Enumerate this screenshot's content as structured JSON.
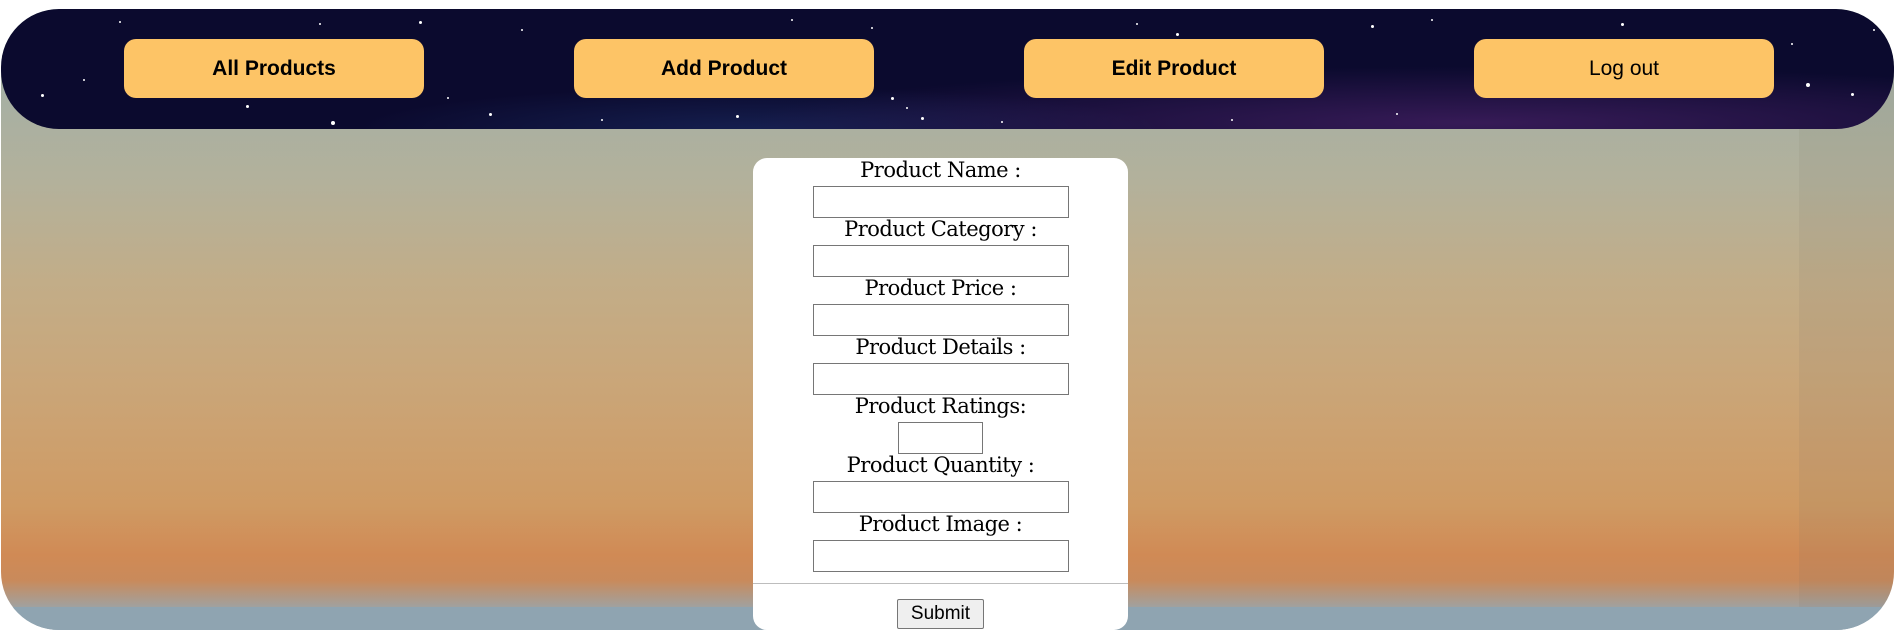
{
  "nav": {
    "items": [
      {
        "label": "All Products"
      },
      {
        "label": "Add Product"
      },
      {
        "label": "Edit Product"
      },
      {
        "label": "Log out"
      }
    ]
  },
  "form": {
    "fields": [
      {
        "label": "Product Name :",
        "value": ""
      },
      {
        "label": "Product Category :",
        "value": ""
      },
      {
        "label": "Product Price :",
        "value": ""
      },
      {
        "label": "Product Details :",
        "value": ""
      },
      {
        "label": "Product Ratings:",
        "value": ""
      },
      {
        "label": "Product Quantity :",
        "value": ""
      },
      {
        "label": "Product Image :",
        "value": ""
      }
    ],
    "submit_label": "Submit"
  },
  "colors": {
    "nav_background": "#0b0a2e",
    "button_background": "#fdc466",
    "card_background": "#ffffff"
  }
}
